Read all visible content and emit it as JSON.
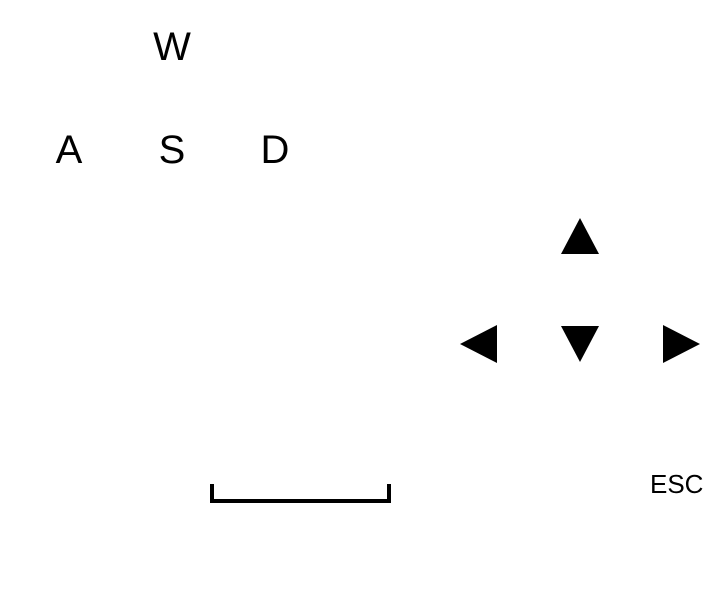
{
  "wasd": {
    "w": "W",
    "a": "A",
    "s": "S",
    "d": "D"
  },
  "arrows": {
    "up_icon": "arrow-up-icon",
    "down_icon": "arrow-down-icon",
    "left_icon": "arrow-left-icon",
    "right_icon": "arrow-right-icon"
  },
  "space": {
    "icon": "spacebar-icon"
  },
  "esc": {
    "label": "ESC"
  },
  "colors": {
    "foreground": "#000000",
    "background": "#ffffff"
  }
}
